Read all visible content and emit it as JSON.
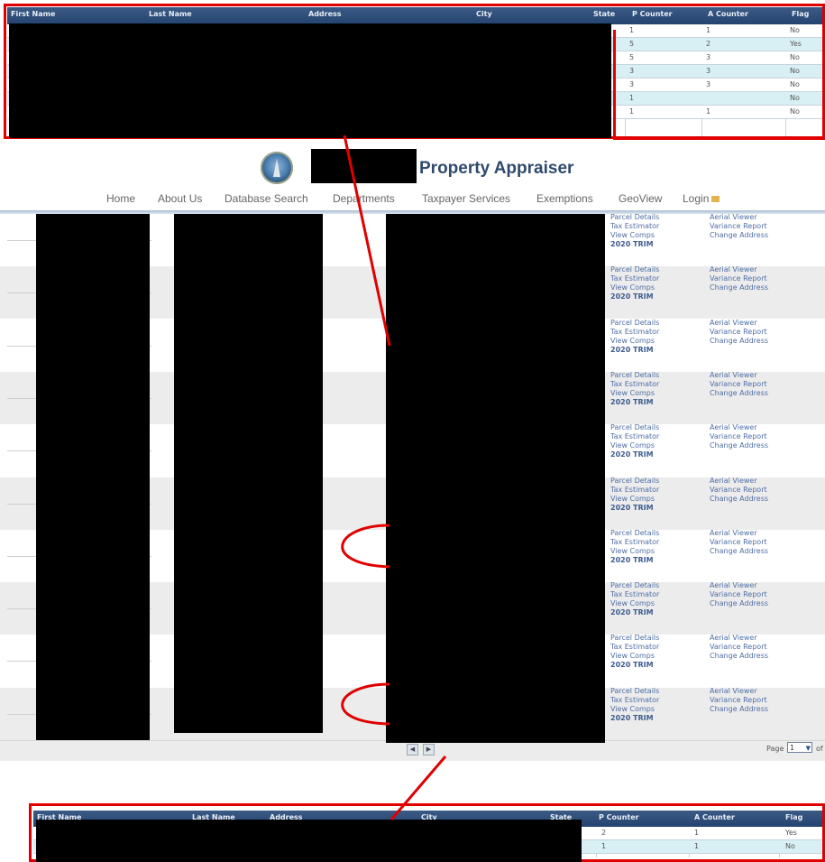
{
  "top_table": {
    "headers": [
      "First Name",
      "Last Name",
      "Address",
      "City",
      "State",
      "P Counter",
      "A Counter",
      "Flag"
    ],
    "rows": [
      {
        "p": "1",
        "a": "1",
        "flag": "No"
      },
      {
        "p": "5",
        "a": "2",
        "flag": "Yes"
      },
      {
        "p": "5",
        "a": "3",
        "flag": "No"
      },
      {
        "p": "3",
        "a": "3",
        "flag": "No"
      },
      {
        "p": "3",
        "a": "3",
        "flag": "No"
      },
      {
        "p": "1",
        "a": "",
        "flag": "No"
      },
      {
        "p": "1",
        "a": "1",
        "flag": "No"
      }
    ]
  },
  "site": {
    "title": "Property Appraiser",
    "logo_icon": "county-seal-icon",
    "nav": [
      "Home",
      "About Us",
      "Database Search",
      "Departments",
      "Taxpayer Services",
      "Exemptions",
      "GeoView",
      "Login"
    ],
    "lock_icon": "lock-icon"
  },
  "results": {
    "links_left": [
      "Parcel Details",
      "Tax Estimator",
      "View Comps",
      "2020 TRIM"
    ],
    "links_right": [
      "Aerial Viewer",
      "Variance Report",
      "Change Address"
    ],
    "row_count": 10
  },
  "pager": {
    "prev_icon": "first-page-icon",
    "next_icon": "next-page-icon",
    "page_label": "Page",
    "page_value": "1",
    "of_label": "of"
  },
  "bottom_table": {
    "headers": [
      "First Name",
      "Last Name",
      "Address",
      "City",
      "State",
      "P Counter",
      "A Counter",
      "Flag"
    ],
    "rows": [
      {
        "p": "2",
        "a": "1",
        "flag": "Yes"
      },
      {
        "p": "1",
        "a": "1",
        "flag": "No"
      }
    ]
  },
  "colors": {
    "annotation_red": "#e00000",
    "link_blue": "#4f6fa5",
    "header_navy": "#2f4a6d"
  }
}
